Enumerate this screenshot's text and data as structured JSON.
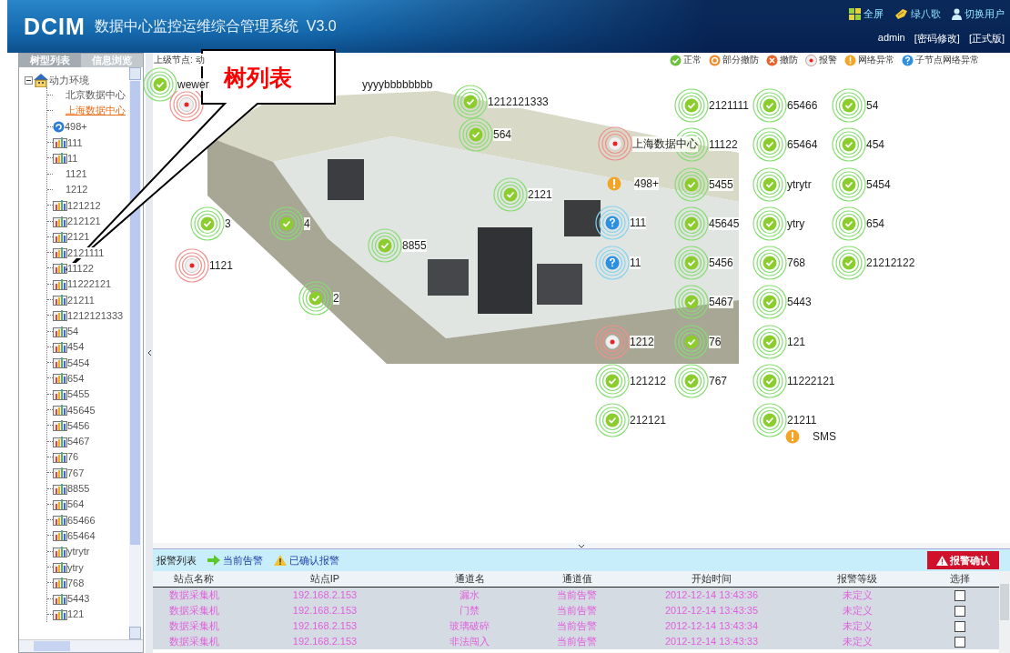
{
  "header": {
    "logo": "DCIM",
    "title": "数据中心监控运维综合管理系统  V3.0",
    "links": [
      {
        "kind": "fullscreen",
        "label": "全屏"
      },
      {
        "kind": "bird",
        "label": "绿八歌"
      },
      {
        "kind": "user",
        "label": "切换用户"
      }
    ],
    "user": "admin",
    "account_links": [
      "[密码修改]",
      "[正式版]"
    ]
  },
  "sidebar": {
    "tabs": [
      {
        "label": "树型列表",
        "selected": true
      },
      {
        "label": "信息浏览",
        "selected": false
      }
    ],
    "tree": {
      "label": "动力环境",
      "expanded": true,
      "children": [
        {
          "label": "北京数据中心",
          "kind": "center",
          "selected": false
        },
        {
          "label": "上海数据中心",
          "kind": "center",
          "selected": true
        },
        {
          "label": "498+",
          "kind": "group",
          "selected": false
        },
        {
          "label": "111",
          "kind": "station",
          "selected": false
        },
        {
          "label": "11",
          "kind": "station",
          "selected": false
        },
        {
          "label": "1121",
          "kind": "center",
          "selected": false
        },
        {
          "label": "1212",
          "kind": "center",
          "selected": false
        },
        {
          "label": "121212",
          "kind": "station",
          "selected": false
        },
        {
          "label": "212121",
          "kind": "station",
          "selected": false
        },
        {
          "label": "2121",
          "kind": "station",
          "selected": false
        },
        {
          "label": "2121111",
          "kind": "station",
          "selected": false
        },
        {
          "label": "11122",
          "kind": "station",
          "selected": false
        },
        {
          "label": "11222121",
          "kind": "station",
          "selected": false
        },
        {
          "label": "21211",
          "kind": "station",
          "selected": false
        },
        {
          "label": "1212121333",
          "kind": "station",
          "selected": false
        },
        {
          "label": "54",
          "kind": "station",
          "selected": false
        },
        {
          "label": "454",
          "kind": "station",
          "selected": false
        },
        {
          "label": "5454",
          "kind": "station",
          "selected": false
        },
        {
          "label": "654",
          "kind": "station",
          "selected": false
        },
        {
          "label": "5455",
          "kind": "station",
          "selected": false
        },
        {
          "label": "45645",
          "kind": "station",
          "selected": false
        },
        {
          "label": "5456",
          "kind": "station",
          "selected": false
        },
        {
          "label": "5467",
          "kind": "station",
          "selected": false
        },
        {
          "label": "76",
          "kind": "station",
          "selected": false
        },
        {
          "label": "767",
          "kind": "station",
          "selected": false
        },
        {
          "label": "8855",
          "kind": "station",
          "selected": false
        },
        {
          "label": "564",
          "kind": "station",
          "selected": false
        },
        {
          "label": "65466",
          "kind": "station",
          "selected": false
        },
        {
          "label": "65464",
          "kind": "station",
          "selected": false
        },
        {
          "label": "ytrytr",
          "kind": "station",
          "selected": false
        },
        {
          "label": "ytry",
          "kind": "station",
          "selected": false
        },
        {
          "label": "768",
          "kind": "station",
          "selected": false
        },
        {
          "label": "5443",
          "kind": "station",
          "selected": false
        },
        {
          "label": "121",
          "kind": "station",
          "selected": false
        }
      ]
    }
  },
  "breadcrumb": "上级节点: 动",
  "legend": [
    {
      "kind": "normal",
      "label": "正常"
    },
    {
      "kind": "partial",
      "label": "部分撤防"
    },
    {
      "kind": "disarm",
      "label": "撤防"
    },
    {
      "kind": "alarm",
      "label": "报警"
    },
    {
      "kind": "network",
      "label": "网络异常"
    },
    {
      "kind": "subnet",
      "label": "子节点网络异常"
    }
  ],
  "map_nodes": [
    {
      "label": "wewer",
      "tail": "yyyybbbbbbbb",
      "kind": "normal"
    },
    {
      "kind": "alarm"
    },
    {
      "label": "1212121333",
      "kind": "normal"
    },
    {
      "label": "564",
      "kind": "normal"
    },
    {
      "label": "上海数据中心",
      "kind": "alarm"
    },
    {
      "label": "498+",
      "kind": "network"
    },
    {
      "label": "2121",
      "kind": "normal"
    },
    {
      "label": "111",
      "kind": "subnet"
    },
    {
      "label": "11",
      "kind": "subnet"
    },
    {
      "label": "3",
      "kind": "normal"
    },
    {
      "label": "4",
      "kind": "normal"
    },
    {
      "label": "8855",
      "kind": "normal"
    },
    {
      "label": "1121",
      "kind": "alarm"
    },
    {
      "label": "2",
      "kind": "normal"
    },
    {
      "label": "1212",
      "kind": "alarm"
    },
    {
      "label": "121212",
      "kind": "normal"
    },
    {
      "label": "212121",
      "kind": "normal"
    },
    {
      "label": "2121111",
      "kind": "normal"
    },
    {
      "label": "11122",
      "kind": "normal"
    },
    {
      "label": "5455",
      "kind": "normal"
    },
    {
      "label": "45645",
      "kind": "normal"
    },
    {
      "label": "5456",
      "kind": "normal"
    },
    {
      "label": "5467",
      "kind": "normal"
    },
    {
      "label": "76",
      "kind": "normal"
    },
    {
      "label": "767",
      "kind": "normal"
    },
    {
      "label": "65466",
      "kind": "normal"
    },
    {
      "label": "65464",
      "kind": "normal"
    },
    {
      "label": "ytrytr",
      "kind": "normal"
    },
    {
      "label": "ytry",
      "kind": "normal"
    },
    {
      "label": "768",
      "kind": "normal"
    },
    {
      "label": "5443",
      "kind": "normal"
    },
    {
      "label": "121",
      "kind": "normal"
    },
    {
      "label": "11222121",
      "kind": "normal"
    },
    {
      "label": "21211",
      "kind": "normal"
    },
    {
      "label": "54",
      "kind": "normal"
    },
    {
      "label": "454",
      "kind": "normal"
    },
    {
      "label": "5454",
      "kind": "normal"
    },
    {
      "label": "654",
      "kind": "normal"
    },
    {
      "label": "21212122",
      "kind": "normal"
    },
    {
      "label": "SMS",
      "kind": "network"
    }
  ],
  "callout": {
    "text": "树列表"
  },
  "alarm_panel": {
    "title": "报警列表",
    "tabs": [
      {
        "kind": "current",
        "label": "当前告警"
      },
      {
        "kind": "confirmed",
        "label": "已确认报警"
      }
    ],
    "confirm_button": "报警确认",
    "columns": [
      "站点名称",
      "站点IP",
      "通道名",
      "通道值",
      "开始时间",
      "报警等级",
      "选择"
    ],
    "rows": [
      {
        "cells": [
          "数据采集机",
          "192.168.2.153",
          "漏水",
          "当前告警",
          "2012-12-14 13:43:36",
          "未定义"
        ],
        "checked": false
      },
      {
        "cells": [
          "数据采集机",
          "192.168.2.153",
          "门禁",
          "当前告警",
          "2012-12-14 13:43:35",
          "未定义"
        ],
        "checked": false
      },
      {
        "cells": [
          "数据采集机",
          "192.168.2.153",
          "玻璃破碎",
          "当前告警",
          "2012-12-14 13:43:34",
          "未定义"
        ],
        "checked": false
      },
      {
        "cells": [
          "数据采集机",
          "192.168.2.153",
          "非法闯入",
          "当前告警",
          "2012-12-14 13:43:33",
          "未定义"
        ],
        "checked": false
      }
    ]
  }
}
